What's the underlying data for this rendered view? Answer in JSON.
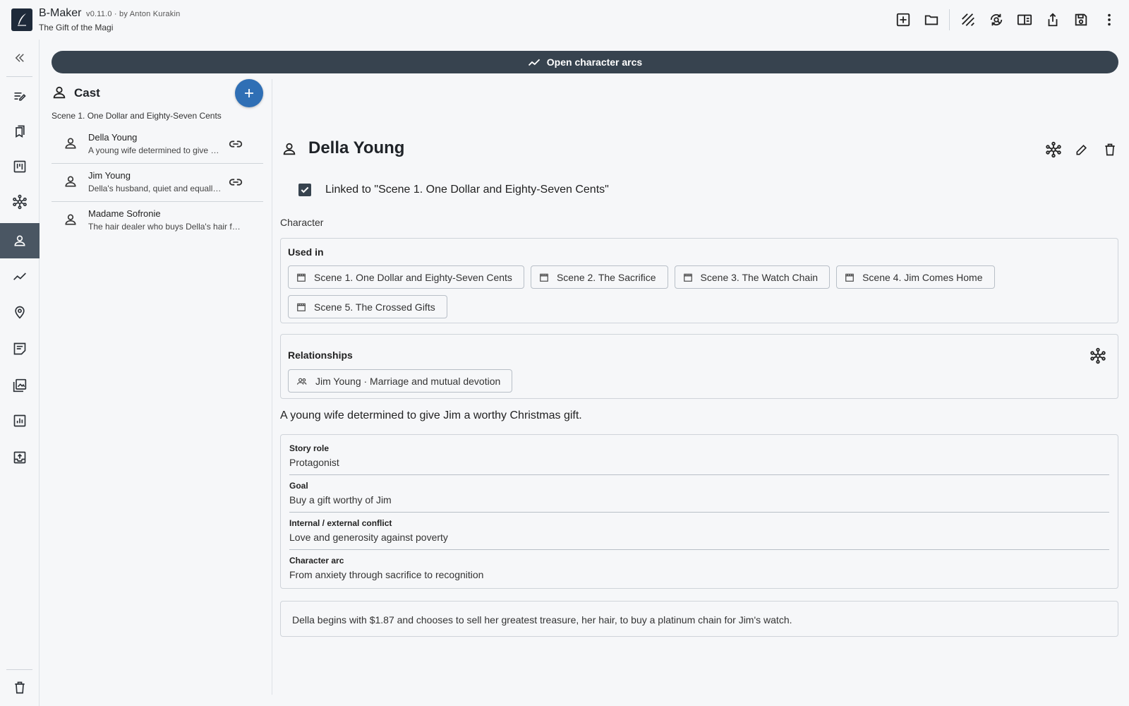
{
  "app": {
    "name": "B-Maker",
    "version": "v0.11.0 · by Anton Kurakin",
    "project": "The Gift of the Magi"
  },
  "toolbar": {
    "icons": [
      "add-box-icon",
      "folder-icon",
      "texture-icon",
      "sync-search-icon",
      "split-view-icon",
      "share-icon",
      "save-icon",
      "more-vert-icon"
    ]
  },
  "rail": {
    "items": [
      "collapse-icon",
      "edit-notes-icon",
      "bookmarks-icon",
      "board-icon",
      "graph-icon",
      "person-icon",
      "timeline-icon",
      "location-icon",
      "notes-icon",
      "gallery-icon",
      "stats-icon",
      "export-icon",
      "trash-icon"
    ],
    "active": "person-icon"
  },
  "arcs_button": {
    "label": "Open character arcs"
  },
  "cast": {
    "title": "Cast",
    "scene": "Scene 1. One Dollar and Eighty-Seven Cents",
    "items": [
      {
        "name": "Della Young",
        "desc": "A young wife determined to give Jim a worthy Christmas gift.",
        "linked": true
      },
      {
        "name": "Jim Young",
        "desc": "Della's husband, quiet and equally devoted.",
        "linked": true
      },
      {
        "name": "Madame Sofronie",
        "desc": "The hair dealer who buys Della's hair for twenty dollars.",
        "linked": false
      }
    ]
  },
  "detail": {
    "name": "Della Young",
    "linked_label": "Linked to \"Scene 1. One Dollar and Eighty-Seven Cents\"",
    "linked_checked": true,
    "section_label": "Character",
    "used_in": {
      "title": "Used in",
      "scenes": [
        "Scene 1. One Dollar and Eighty-Seven Cents",
        "Scene 2. The Sacrifice",
        "Scene 3. The Watch Chain",
        "Scene 4. Jim Comes Home",
        "Scene 5. The Crossed Gifts"
      ]
    },
    "relationships": {
      "title": "Relationships",
      "items": [
        "Jim Young · Marriage and mutual devotion"
      ]
    },
    "description": "A young wife determined to give Jim a worthy Christmas gift.",
    "fields": [
      {
        "label": "Story role",
        "value": "Protagonist"
      },
      {
        "label": "Goal",
        "value": "Buy a gift worthy of Jim"
      },
      {
        "label": "Internal / external conflict",
        "value": "Love and generosity against poverty"
      },
      {
        "label": "Character arc",
        "value": "From anxiety through sacrifice to recognition"
      }
    ],
    "note": "Della begins with $1.87 and chooses to sell her greatest treasure, her hair, to buy a platinum chain for Jim's watch."
  }
}
